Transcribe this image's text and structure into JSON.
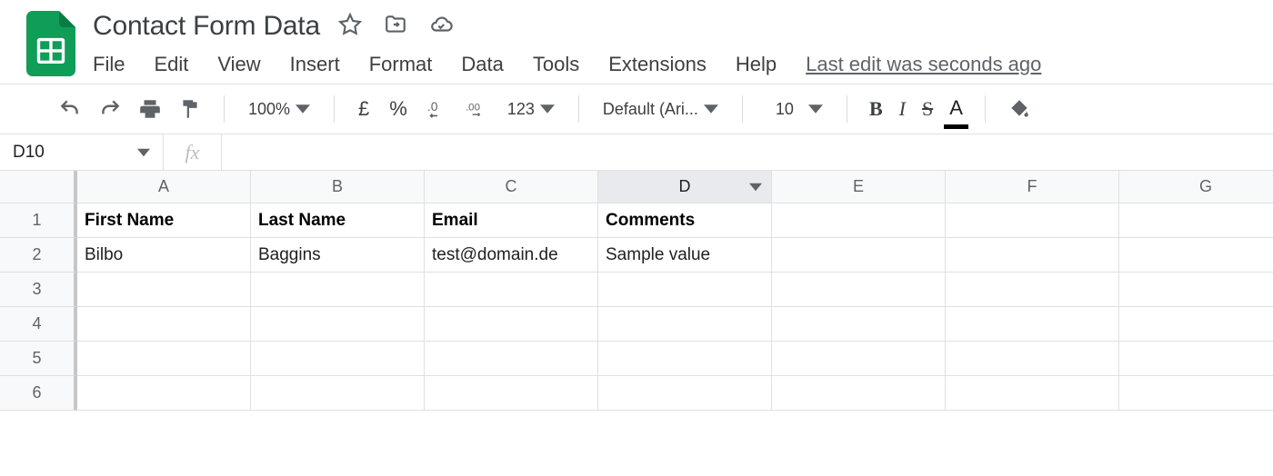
{
  "doc": {
    "title": "Contact Form Data"
  },
  "menu": {
    "items": [
      "File",
      "Edit",
      "View",
      "Insert",
      "Format",
      "Data",
      "Tools",
      "Extensions",
      "Help"
    ],
    "last_edit": "Last edit was seconds ago"
  },
  "toolbar": {
    "zoom": "100%",
    "currency_symbol": "£",
    "percent_symbol": "%",
    "dec_less": ".0",
    "dec_more": ".00",
    "format_more": "123",
    "font": "Default (Ari...",
    "font_size": "10",
    "bold": "B",
    "italic": "I",
    "strike": "S",
    "text_color": "A"
  },
  "fx": {
    "cell_ref": "D10",
    "formula_label": "fx",
    "value": ""
  },
  "sheet": {
    "columns": [
      "A",
      "B",
      "C",
      "D",
      "E",
      "F",
      "G"
    ],
    "active_column": "D",
    "row_numbers": [
      "1",
      "2",
      "3",
      "4",
      "5",
      "6"
    ],
    "header_row": [
      "First Name",
      "Last Name",
      "Email",
      "Comments"
    ],
    "rows": [
      [
        "Bilbo",
        "Baggins",
        "test@domain.de",
        "Sample value"
      ]
    ]
  }
}
